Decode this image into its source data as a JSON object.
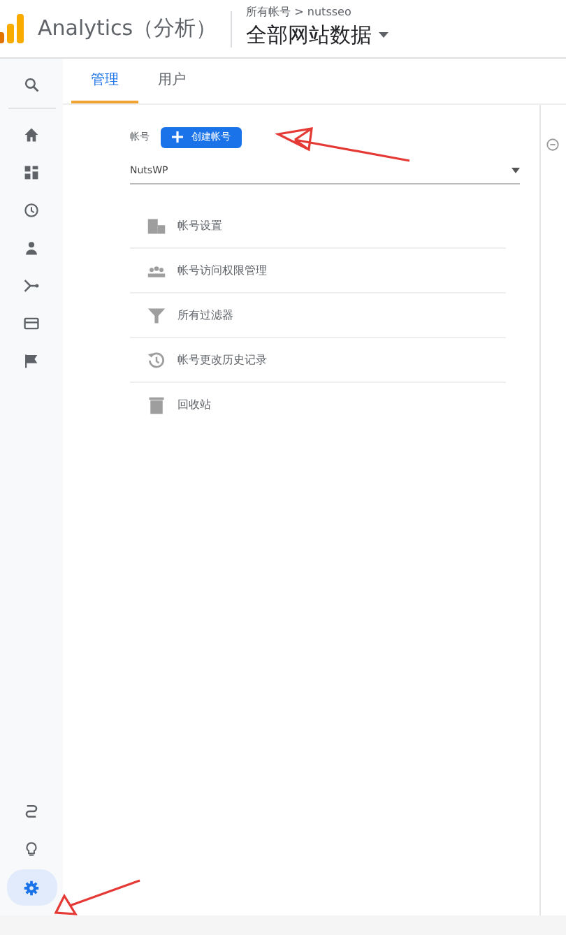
{
  "header": {
    "product": "Analytics（分析）",
    "breadcrumb": "所有帐号 > nutsseo",
    "property": "全部网站数据"
  },
  "sidebar": {
    "top": [
      {
        "kind": "search",
        "selected": false
      },
      {
        "kind": "home",
        "selected": false
      },
      {
        "kind": "dashboard",
        "selected": false
      },
      {
        "kind": "clock",
        "selected": false
      },
      {
        "kind": "person",
        "selected": false
      },
      {
        "kind": "branch",
        "selected": false
      },
      {
        "kind": "card",
        "selected": false
      },
      {
        "kind": "flag",
        "selected": false
      }
    ],
    "bottom": [
      {
        "kind": "route",
        "selected": false
      },
      {
        "kind": "bulb",
        "selected": false
      },
      {
        "kind": "gear",
        "selected": true
      }
    ]
  },
  "tabs": [
    {
      "label": "管理",
      "selected": true
    },
    {
      "label": "用户",
      "selected": false
    }
  ],
  "account": {
    "label": "帐号",
    "create_button": "创建帐号",
    "select_value": "NutsWP"
  },
  "menu": [
    {
      "kind": "building",
      "label": "帐号设置"
    },
    {
      "kind": "people",
      "label": "帐号访问权限管理"
    },
    {
      "kind": "filter",
      "label": "所有过滤器"
    },
    {
      "kind": "history",
      "label": "帐号更改历史记录"
    },
    {
      "kind": "trash",
      "label": "回收站"
    }
  ]
}
